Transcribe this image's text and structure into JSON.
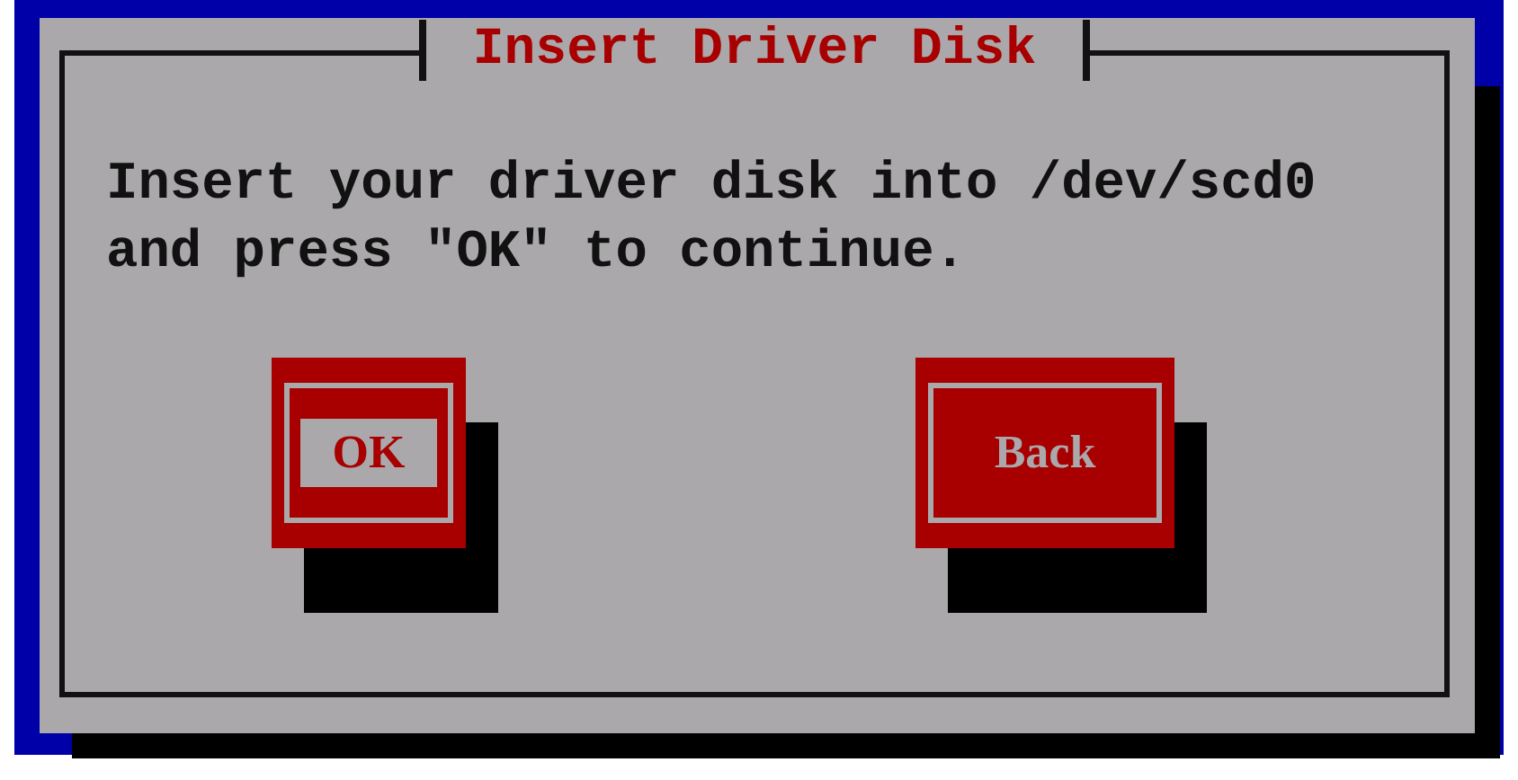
{
  "window": {
    "title": "Insert Driver Disk"
  },
  "message": "Insert your driver disk into /dev/scd0 and press \"OK\" to continue.",
  "buttons": [
    {
      "label": "OK",
      "selected": true
    },
    {
      "label": "Back",
      "selected": false
    }
  ]
}
